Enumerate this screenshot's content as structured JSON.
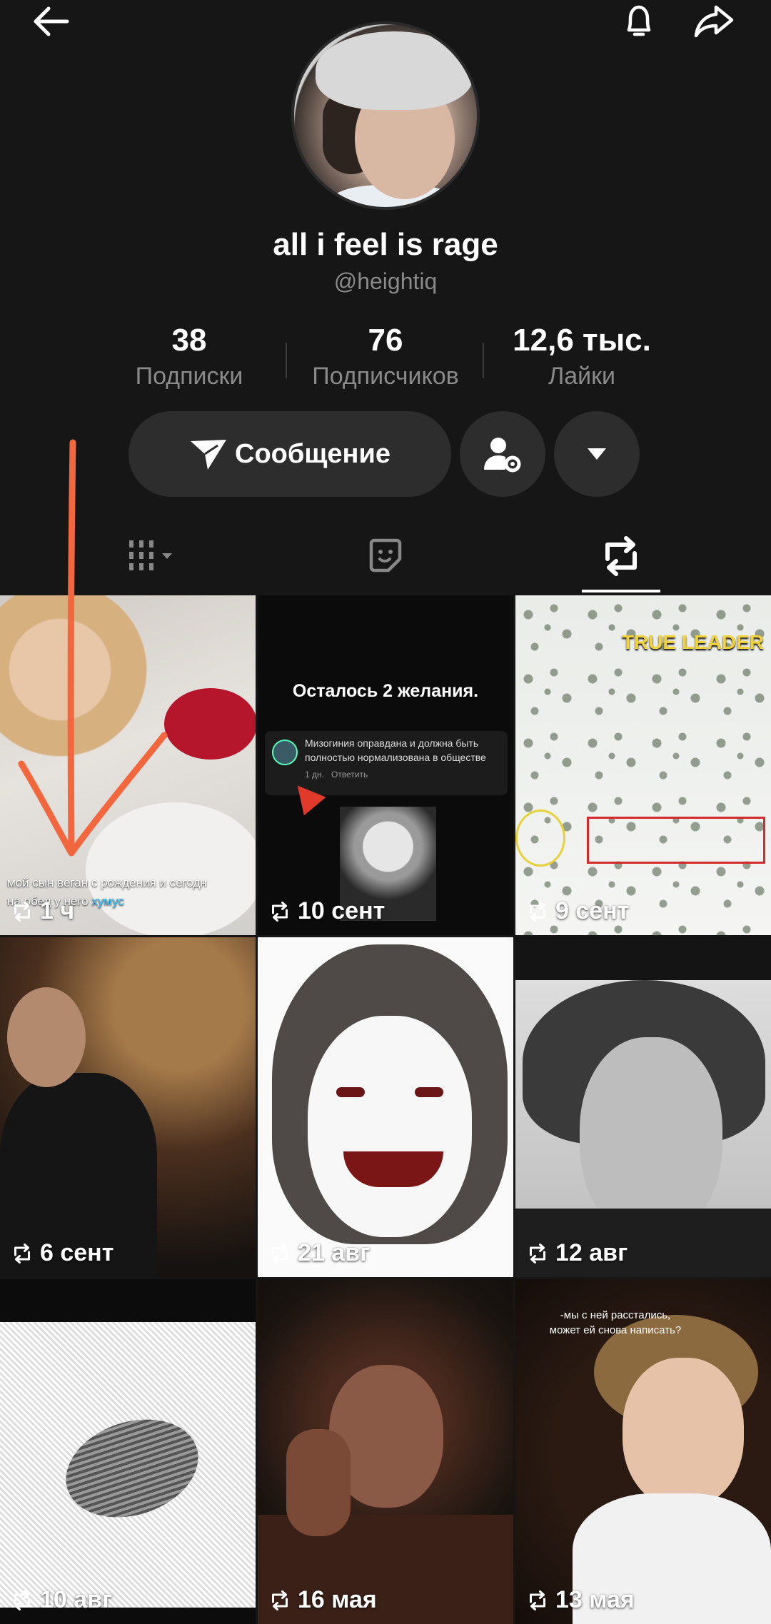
{
  "profile": {
    "display_name": "all i feel is rage",
    "handle": "@heightiq"
  },
  "stats": [
    {
      "value": "38",
      "label": "Подписки"
    },
    {
      "value": "76",
      "label": "Подписчиков"
    },
    {
      "value": "12,6 тыс.",
      "label": "Лайки"
    }
  ],
  "actions": {
    "message_label": "Сообщение"
  },
  "tabs": [
    {
      "icon": "grid-icon"
    },
    {
      "icon": "sticker-icon"
    },
    {
      "icon": "repost-icon",
      "active": true
    }
  ],
  "grid": [
    {
      "date": "1 ч",
      "caption": "мой сын веган с рождения и сегодн",
      "caption2": "на обед у него ",
      "caption_hl": "хумус"
    },
    {
      "date": "10 сент",
      "title": "Осталось 2 желания.",
      "comment": "Мизогиния оправдана и должна быть полностью нормализована в обществе",
      "comment_time": "1 дн.",
      "comment_reply": "Ответить"
    },
    {
      "date": "9 сент",
      "label": "TRUE LEADER"
    },
    {
      "date": "6 сент"
    },
    {
      "date": "21 авг"
    },
    {
      "date": "12 авг"
    },
    {
      "date": "10 авг"
    },
    {
      "date": "16 мая"
    },
    {
      "date": "13 мая",
      "caption": "-мы с ней расстались,",
      "caption2": "может ей снова написать?"
    }
  ],
  "colors": {
    "background": "#161616",
    "button_bg": "#2d2d2d",
    "secondary_text": "#8a8a8a",
    "annotation_arrow": "#f2673d"
  }
}
